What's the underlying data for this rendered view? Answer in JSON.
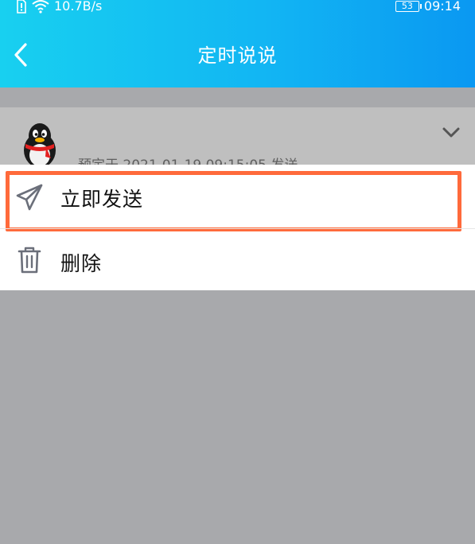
{
  "status_bar": {
    "network_speed": "10.7B/s",
    "battery_level": "53",
    "time": "09:14"
  },
  "header": {
    "title": "定时说说",
    "back_icon": "chevron-left-icon",
    "gradient_start": "#18d0f0",
    "gradient_end": "#0a98f2"
  },
  "post": {
    "avatar_icon": "qq-penguin-avatar-icon",
    "scheduled_text": "预定于 2021-01-19 09:15:05 发送",
    "expand_icon": "chevron-down-icon"
  },
  "action_sheet": {
    "items": [
      {
        "label": "立即发送",
        "icon": "paper-plane-icon",
        "highlighted": true
      },
      {
        "label": "删除",
        "icon": "trash-icon",
        "highlighted": false
      }
    ],
    "highlight_color": "#ff6a3b"
  },
  "overlay_color": "#a8a9ac"
}
